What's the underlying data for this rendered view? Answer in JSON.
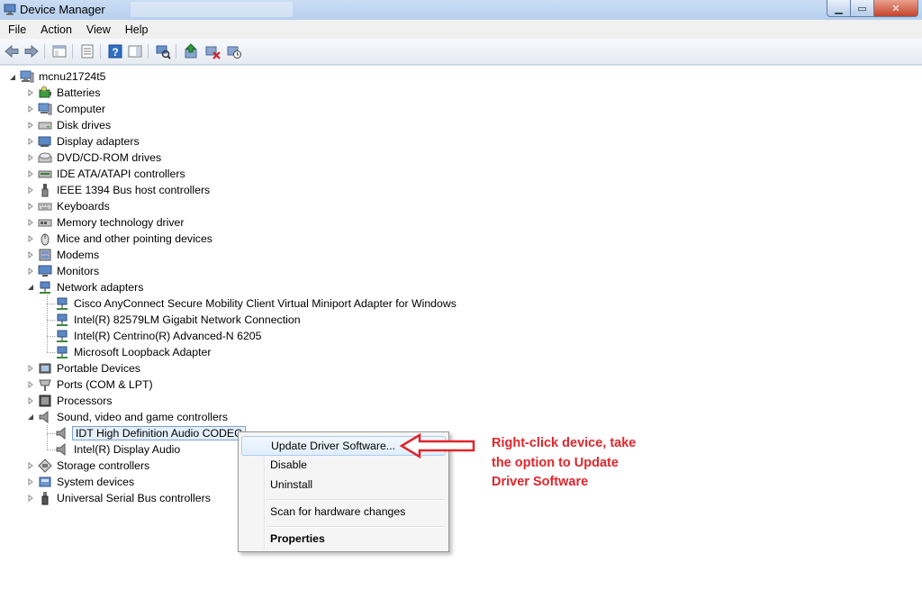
{
  "window": {
    "title": "Device Manager"
  },
  "menu": [
    "File",
    "Action",
    "View",
    "Help"
  ],
  "toolbar_icons": [
    "back-icon",
    "forward-icon",
    "console-tree-icon",
    "properties-icon",
    "help-icon",
    "action-pane-icon",
    "scan-hardware-icon",
    "update-driver-icon",
    "uninstall-icon",
    "disable-icon"
  ],
  "tree": {
    "root": "mcnu21724t5",
    "categories": [
      {
        "label": "Batteries",
        "icon": "battery-icon",
        "expanded": false
      },
      {
        "label": "Computer",
        "icon": "computer-icon",
        "expanded": false
      },
      {
        "label": "Disk drives",
        "icon": "disk-drive-icon",
        "expanded": false
      },
      {
        "label": "Display adapters",
        "icon": "display-adapter-icon",
        "expanded": false
      },
      {
        "label": "DVD/CD-ROM drives",
        "icon": "dvd-drive-icon",
        "expanded": false
      },
      {
        "label": "IDE ATA/ATAPI controllers",
        "icon": "ide-controller-icon",
        "expanded": false
      },
      {
        "label": "IEEE 1394 Bus host controllers",
        "icon": "firewire-icon",
        "expanded": false
      },
      {
        "label": "Keyboards",
        "icon": "keyboard-icon",
        "expanded": false
      },
      {
        "label": "Memory technology driver",
        "icon": "memory-icon",
        "expanded": false
      },
      {
        "label": "Mice and other pointing devices",
        "icon": "mouse-icon",
        "expanded": false
      },
      {
        "label": "Modems",
        "icon": "modem-icon",
        "expanded": false
      },
      {
        "label": "Monitors",
        "icon": "monitor-icon",
        "expanded": false
      },
      {
        "label": "Network adapters",
        "icon": "network-adapter-icon",
        "expanded": true,
        "children": [
          "Cisco AnyConnect Secure Mobility Client Virtual Miniport Adapter for Windows",
          "Intel(R) 82579LM Gigabit Network Connection",
          "Intel(R) Centrino(R) Advanced-N 6205",
          "Microsoft Loopback Adapter"
        ]
      },
      {
        "label": "Portable Devices",
        "icon": "portable-device-icon",
        "expanded": false
      },
      {
        "label": "Ports (COM & LPT)",
        "icon": "port-icon",
        "expanded": false
      },
      {
        "label": "Processors",
        "icon": "processor-icon",
        "expanded": false
      },
      {
        "label": "Sound, video and game controllers",
        "icon": "speaker-icon",
        "expanded": true,
        "children": [
          "IDT High Definition Audio CODEC",
          "Intel(R) Display Audio"
        ]
      },
      {
        "label": "Storage controllers",
        "icon": "storage-controller-icon",
        "expanded": false
      },
      {
        "label": "System devices",
        "icon": "system-device-icon",
        "expanded": false
      },
      {
        "label": "Universal Serial Bus controllers",
        "icon": "usb-icon",
        "expanded": false
      }
    ]
  },
  "selected_device": "IDT High Definition Audio CODEC",
  "context_menu": {
    "update": "Update Driver Software...",
    "disable": "Disable",
    "uninstall": "Uninstall",
    "scan": "Scan for hardware changes",
    "properties": "Properties"
  },
  "annotation": {
    "line1": "Right-click device, take",
    "line2": "the option to Update",
    "line3": "Driver Software",
    "color": "#e0262b"
  }
}
